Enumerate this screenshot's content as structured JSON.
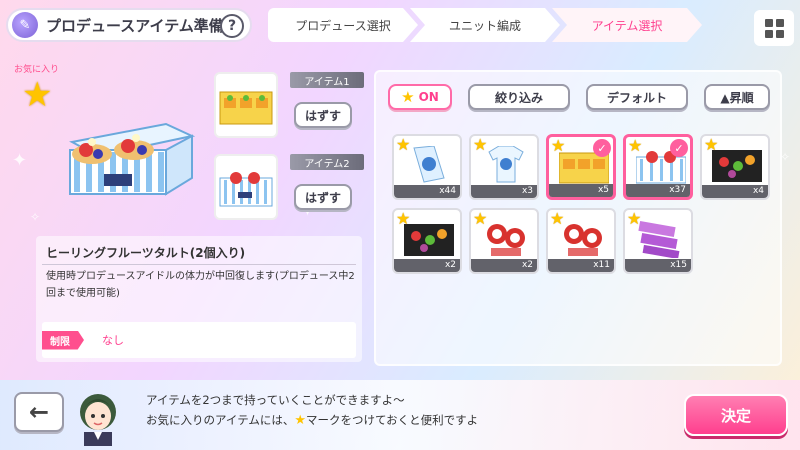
{
  "header": {
    "title": "プロデュースアイテム準備",
    "help_label": "?",
    "steps": [
      "プロデュース選択",
      "ユニット編成",
      "アイテム選択"
    ],
    "active_step": 2
  },
  "favorite": {
    "label": "お気に入り"
  },
  "slots": [
    {
      "tag": "アイテム1",
      "remove_label": "はずす",
      "art": "lemon-tart-box"
    },
    {
      "tag": "アイテム2",
      "remove_label": "はずす",
      "art": "fruit-tart-box"
    }
  ],
  "detail": {
    "name": "ヒーリングフルーツタルト(2個入り)",
    "description": "使用時プロデュースアイドルの体力が中回復します(プロデュース中2回まで使用可能)",
    "limit_label": "制限",
    "limit_value": "なし"
  },
  "filters": {
    "on_label": "ON",
    "narrow_label": "絞り込み",
    "default_label": "デフォルト",
    "sort_label": "▲昇順"
  },
  "items": [
    {
      "art": "drink-carton",
      "count": "x44",
      "selected": false
    },
    {
      "art": "tshirt",
      "count": "x3",
      "selected": false
    },
    {
      "art": "lemon-tart-box",
      "count": "x5",
      "selected": true
    },
    {
      "art": "fruit-tart-box",
      "count": "x37",
      "selected": true
    },
    {
      "art": "bento-box",
      "count": "x4",
      "selected": false
    },
    {
      "art": "bento-box",
      "count": "x2",
      "selected": false
    },
    {
      "art": "charm-red",
      "count": "x2",
      "selected": false
    },
    {
      "art": "charm-red",
      "count": "x11",
      "selected": false
    },
    {
      "art": "tickets",
      "count": "x15",
      "selected": false
    }
  ],
  "bottom": {
    "back_label": "←",
    "message_line1": "アイテムを2つまで持っていくことができますよ～",
    "message_line2a": "お気に入りのアイテムには、",
    "message_line2b": "マークをつけておくと便利ですよ",
    "decide_label": "決定"
  },
  "colors": {
    "accent_pink": "#ff3f8e",
    "star_yellow": "#ffc400"
  }
}
